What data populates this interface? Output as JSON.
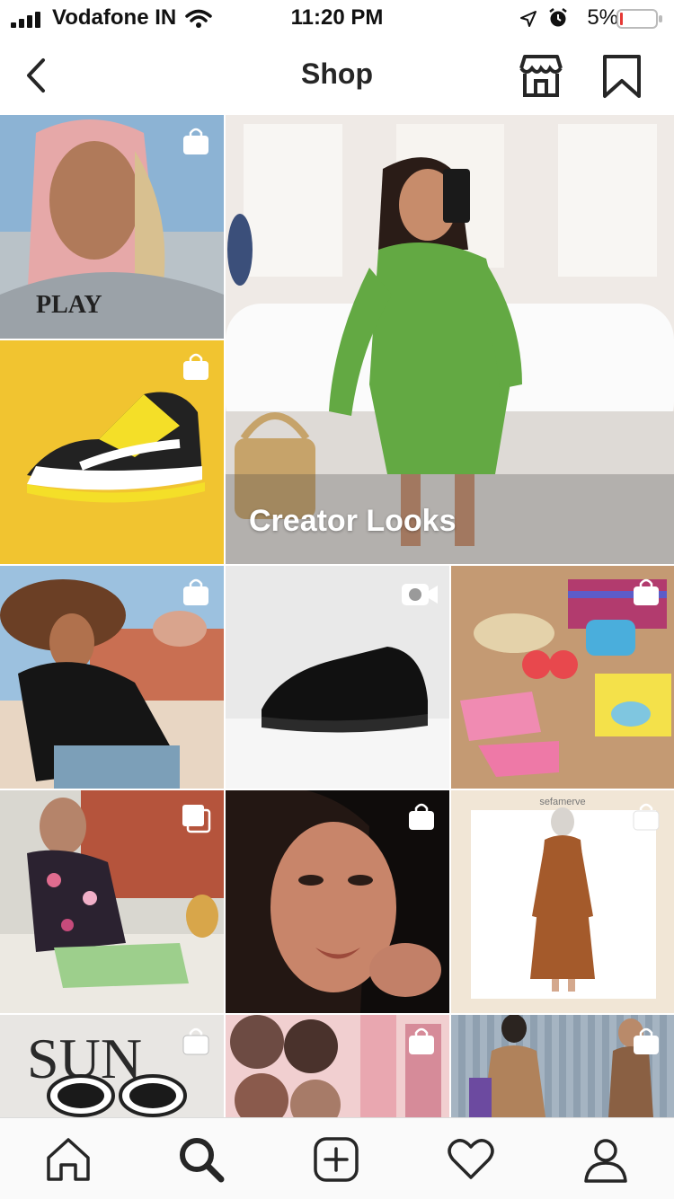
{
  "status_bar": {
    "carrier": "Vodafone IN",
    "time": "11:20 PM",
    "battery_percent": "5%",
    "icons": [
      "signal-icon",
      "wifi-icon",
      "location-icon",
      "alarm-icon",
      "battery-icon"
    ]
  },
  "header": {
    "title": "Shop",
    "left_icon": "back-arrow-icon",
    "right_icons": [
      "storefront-icon",
      "bookmark-icon"
    ]
  },
  "grid": {
    "featured_tile_label": "Creator Looks",
    "tiles": [
      {
        "name": "pink-hair-portrait",
        "badge": "shopping-bag-icon"
      },
      {
        "name": "yellow-sneaker",
        "badge": "shopping-bag-icon"
      },
      {
        "name": "creator-looks-green-dress",
        "badge": ""
      },
      {
        "name": "sun-hat-mosque",
        "badge": "shopping-bag-icon"
      },
      {
        "name": "black-sneaker",
        "badge": "video-camera-icon"
      },
      {
        "name": "kids-swimwear",
        "badge": "shopping-bag-icon"
      },
      {
        "name": "floral-shirt-man",
        "badge": "carousel-icon"
      },
      {
        "name": "makeup-portrait",
        "badge": "shopping-bag-icon"
      },
      {
        "name": "brown-dress",
        "badge": "shopping-bag-icon"
      },
      {
        "name": "sunglasses-magazine",
        "badge": "shopping-bag-icon"
      },
      {
        "name": "eyeshadow-palette",
        "badge": "shopping-bag-icon"
      },
      {
        "name": "street-style",
        "badge": "shopping-bag-icon"
      }
    ]
  },
  "tab_bar": {
    "items": [
      "home-icon",
      "search-icon",
      "new-post-icon",
      "activity-heart-icon",
      "profile-icon"
    ],
    "active": "search-icon"
  },
  "colors": {
    "text": "#262626",
    "divider": "#dbdbdb",
    "tab_background": "#fafafa"
  }
}
